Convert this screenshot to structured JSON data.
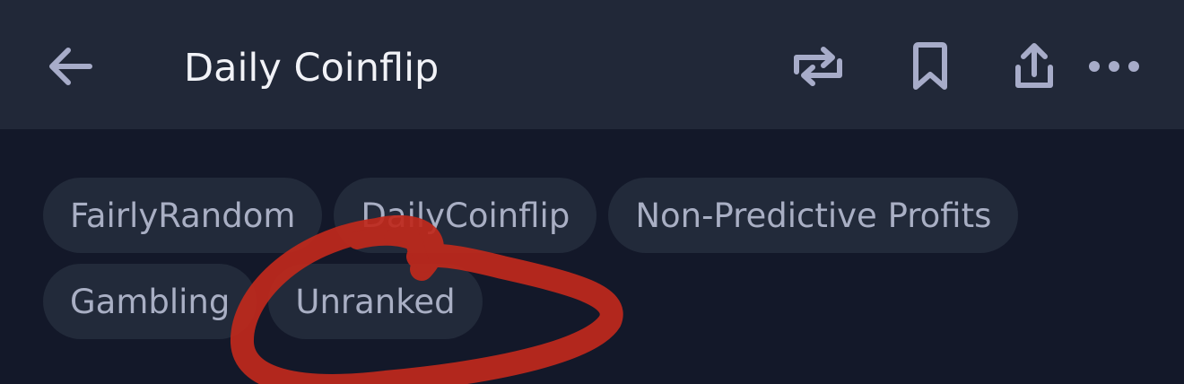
{
  "header": {
    "title": "Daily Coinflip",
    "back_icon": "arrow-left-icon",
    "actions": [
      {
        "name": "repost",
        "icon": "repost-icon"
      },
      {
        "name": "bookmark",
        "icon": "bookmark-icon"
      },
      {
        "name": "share",
        "icon": "share-icon"
      },
      {
        "name": "more",
        "icon": "more-horizontal-icon"
      }
    ]
  },
  "tags": [
    {
      "label": "FairlyRandom"
    },
    {
      "label": "DailyCoinflip"
    },
    {
      "label": "Non-Predictive Profits"
    },
    {
      "label": "Gambling"
    },
    {
      "label": "Unranked"
    }
  ],
  "annotation": {
    "type": "hand-drawn circle around Unranked tag",
    "color": "#c0291c"
  },
  "colors": {
    "background": "#131829",
    "header": "#212838",
    "tag_bg": "#222a3a",
    "tag_text": "#a9afc4",
    "icon": "#a7acc9",
    "title": "#f1f2f7"
  }
}
